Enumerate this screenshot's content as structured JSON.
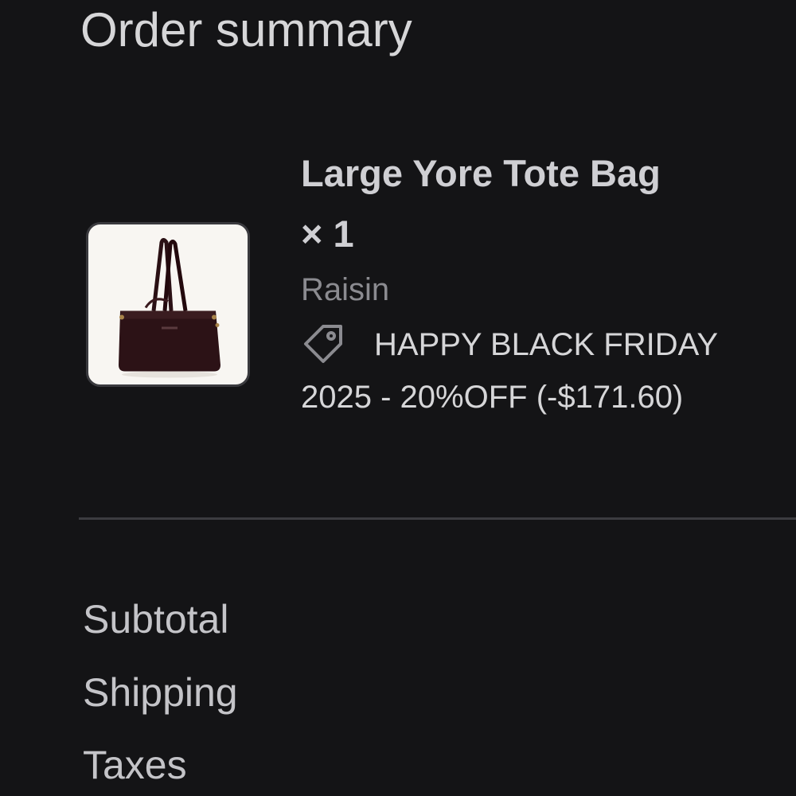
{
  "header": {
    "title": "Order summary"
  },
  "product": {
    "name": "Large Yore Tote Bag",
    "quantity": "× 1",
    "variant": "Raisin",
    "image_alt": "Large Yore Tote Bag in Raisin",
    "discount": {
      "icon": "tag-icon",
      "code": "HAPPY BLACK FRIDAY 2025 - 20%OFF",
      "amount": "(-$171.60)"
    }
  },
  "summary": {
    "subtotal_label": "Subtotal",
    "shipping_label": "Shipping",
    "taxes_label": "Taxes"
  },
  "colors": {
    "background": "#141416",
    "primary_text": "#d6d6d8",
    "secondary_text": "#8b8b90",
    "divider": "#3c3c40",
    "bag_leather": "#2c1216"
  }
}
